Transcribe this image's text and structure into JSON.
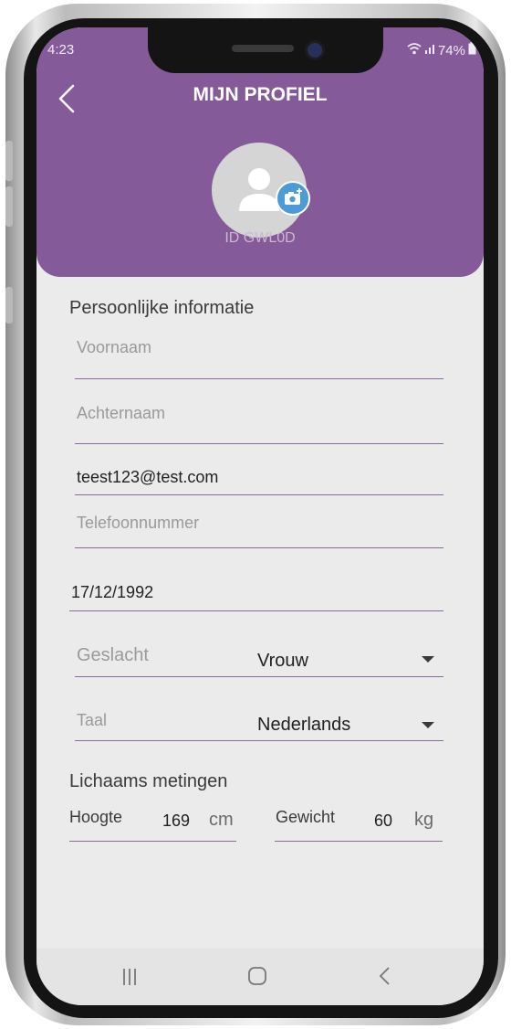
{
  "status_bar": {
    "time": "4:23",
    "battery": "74%"
  },
  "header": {
    "title": "MIJN PROFIEL",
    "user_id": "ID GWL0D"
  },
  "personal": {
    "section_title": "Persoonlijke informatie",
    "first_name_placeholder": "Voornaam",
    "last_name_placeholder": "Achternaam",
    "email_value": "teest123@test.com",
    "phone_placeholder": "Telefoonnummer",
    "birthdate_value": "17/12/1992",
    "gender_label": "Geslacht",
    "gender_value": "Vrouw",
    "language_label": "Taal",
    "language_value": "Nederlands"
  },
  "body": {
    "section_title": "Lichaams metingen",
    "height_label": "Hoogte",
    "height_value": "169",
    "height_unit": "cm",
    "weight_label": "Gewicht",
    "weight_value": "60",
    "weight_unit": "kg"
  },
  "colors": {
    "header": "#855a98",
    "accent_line": "#8a6a9e",
    "camera_badge": "#4d9bd6",
    "screen_bg": "#ebebeb"
  },
  "icons": [
    "back-arrow-icon",
    "user-icon",
    "camera-add-icon",
    "wifi-icon",
    "signal-icon",
    "battery-icon",
    "dropdown-arrow-icon",
    "recent-apps-icon",
    "home-icon",
    "back-nav-icon"
  ]
}
